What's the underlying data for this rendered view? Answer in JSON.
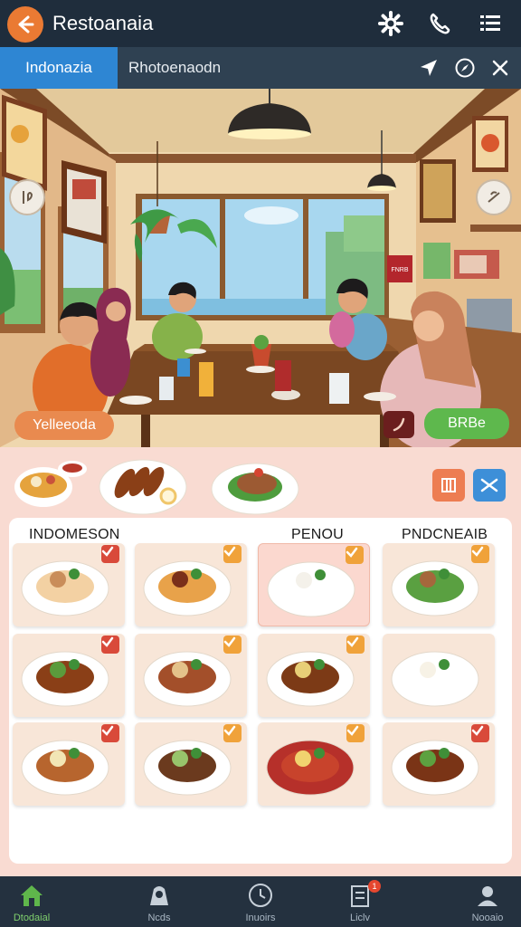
{
  "header": {
    "title": "Restoanaia",
    "icons": [
      "back-arrow-icon",
      "gear-icon",
      "phone-icon",
      "menu-list-icon"
    ]
  },
  "tabs": {
    "active_label": "Indonazia",
    "second_label": "Rhotoenaodn",
    "icons": [
      "navigate-icon",
      "compass-icon",
      "close-icon"
    ]
  },
  "scene": {
    "left_button_label": "Yelleeoda",
    "right_button_label": "BRBe",
    "wall_sign": "FNRB"
  },
  "menu": {
    "column_headers": [
      "INDOMESON",
      "PENOU",
      "PNDCNEAIB"
    ],
    "action_icons": [
      "grid-icon",
      "shuffle-icon"
    ],
    "dishes": [
      {
        "name": "roast-chicken-dish",
        "checked": true
      },
      {
        "name": "noodle-bowl-dish",
        "checked": true
      },
      {
        "name": "white-rice-dish",
        "checked": true
      },
      {
        "name": "grilled-meat-salad-dish",
        "checked": true
      },
      {
        "name": "sausage-rice-dish",
        "checked": true
      },
      {
        "name": "steak-vegetable-dish",
        "checked": true
      },
      {
        "name": "meatball-noodle-dish",
        "checked": true
      },
      {
        "name": "rice-mound-dish",
        "checked": false
      },
      {
        "name": "mixed-platter-dish",
        "checked": true
      },
      {
        "name": "meatball-plate-dish",
        "checked": true
      },
      {
        "name": "meatball-soup-dish",
        "checked": true
      },
      {
        "name": "sausage-plate-dish",
        "checked": true
      }
    ]
  },
  "bottom_nav": {
    "items": [
      {
        "label": "Dtodaial",
        "icon": "home-icon"
      },
      {
        "label": "Ncds",
        "icon": "food-icon"
      },
      {
        "label": "Inuoirs",
        "icon": "clock-icon"
      },
      {
        "label": "Liclv",
        "icon": "order-icon",
        "badge": "1"
      },
      {
        "label": "Nooaio",
        "icon": "profile-icon"
      }
    ]
  },
  "colors": {
    "accent_orange": "#ea7a33",
    "accent_blue": "#2e86d3",
    "accent_green": "#5eb84d",
    "topbar_bg": "#1f2d3c",
    "panel_bg": "#f9dbd2"
  }
}
